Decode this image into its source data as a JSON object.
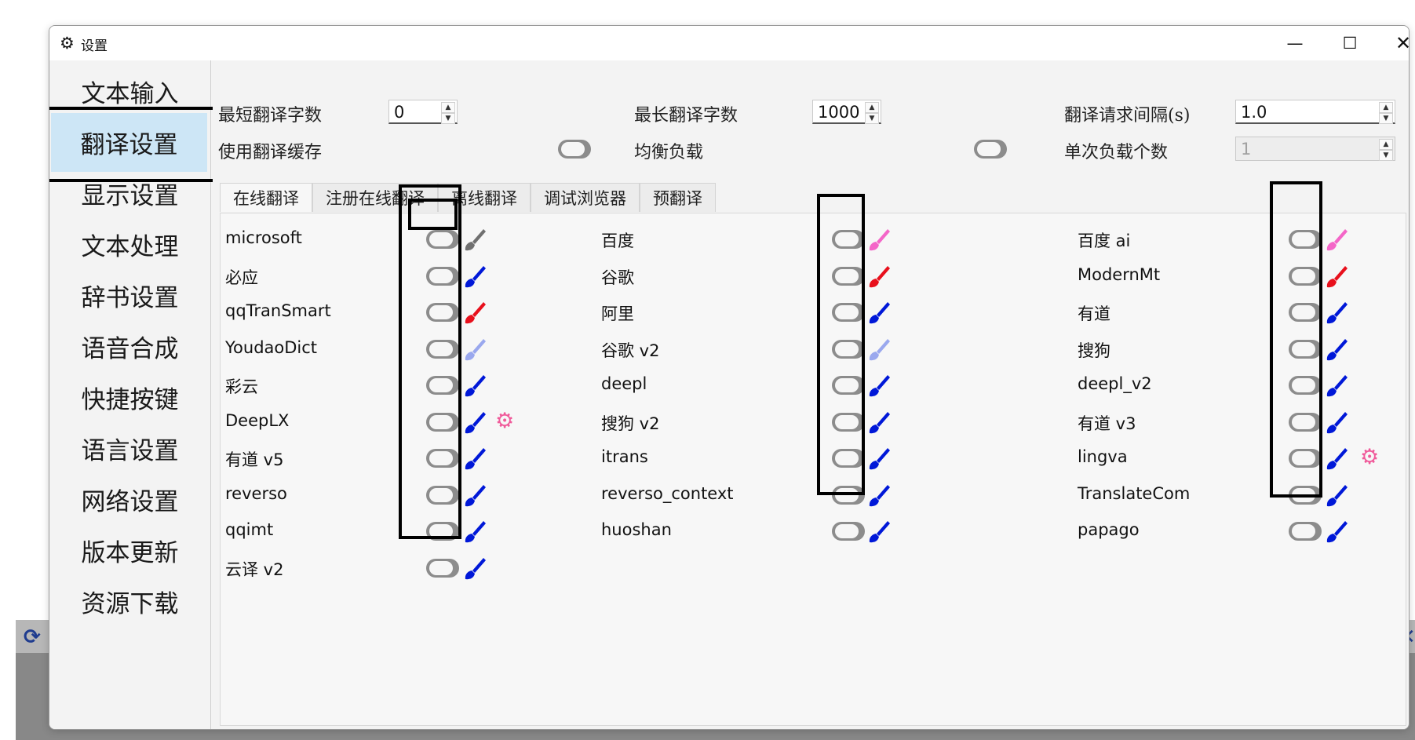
{
  "window": {
    "title": "设置",
    "title_icon": "gear-icon",
    "controls": [
      "minimize",
      "maximize",
      "close"
    ]
  },
  "background": {
    "left_icon": "refresh-icon",
    "right_icon": "close-icon"
  },
  "sidebar": {
    "items": [
      {
        "label": "文本输入"
      },
      {
        "label": "翻译设置",
        "active": true
      },
      {
        "label": "显示设置"
      },
      {
        "label": "文本处理"
      },
      {
        "label": "辞书设置"
      },
      {
        "label": "语音合成"
      },
      {
        "label": "快捷按键"
      },
      {
        "label": "语言设置"
      },
      {
        "label": "网络设置"
      },
      {
        "label": "版本更新"
      },
      {
        "label": "资源下载"
      }
    ]
  },
  "settings": {
    "min_chars_label": "最短翻译字数",
    "min_chars_value": "0",
    "max_chars_label": "最长翻译字数",
    "max_chars_value": "1000",
    "interval_label": "翻译请求间隔(s)",
    "interval_value": "1.0",
    "cache_label": "使用翻译缓存",
    "balance_label": "均衡负载",
    "per_load_label": "单次负载个数",
    "per_load_value": "1"
  },
  "tabs": [
    {
      "label": "在线翻译",
      "active": true
    },
    {
      "label": "注册在线翻译"
    },
    {
      "label": "离线翻译"
    },
    {
      "label": "调试浏览器"
    },
    {
      "label": "预翻译"
    }
  ],
  "translators": {
    "col1": [
      {
        "name": "microsoft",
        "color": "#707070"
      },
      {
        "name": "必应",
        "color": "#0018d8"
      },
      {
        "name": "qqTranSmart",
        "color": "#e8101c"
      },
      {
        "name": "YoudaoDict",
        "color": "#9aa8ee"
      },
      {
        "name": "彩云",
        "color": "#0018d8"
      },
      {
        "name": "DeepLX",
        "color": "#0018d8",
        "gear": true
      },
      {
        "name": "有道 v5",
        "color": "#0018d8"
      },
      {
        "name": "reverso",
        "color": "#0018d8"
      },
      {
        "name": "qqimt",
        "color": "#0018d8"
      },
      {
        "name": "云译 v2",
        "color": "#0018d8"
      }
    ],
    "col2": [
      {
        "name": "百度",
        "color": "#f466c8"
      },
      {
        "name": "谷歌",
        "color": "#e8101c"
      },
      {
        "name": "阿里",
        "color": "#0018d8"
      },
      {
        "name": "谷歌 v2",
        "color": "#9aa8ee"
      },
      {
        "name": "deepl",
        "color": "#0018d8"
      },
      {
        "name": "搜狗 v2",
        "color": "#0018d8"
      },
      {
        "name": "itrans",
        "color": "#0018d8"
      },
      {
        "name": "reverso_context",
        "color": "#0018d8"
      },
      {
        "name": "huoshan",
        "color": "#0018d8"
      }
    ],
    "col3": [
      {
        "name": "百度 ai",
        "color": "#f466c8"
      },
      {
        "name": "ModernMt",
        "color": "#e8101c"
      },
      {
        "name": "有道",
        "color": "#0018d8"
      },
      {
        "name": "搜狗",
        "color": "#0018d8"
      },
      {
        "name": "deepl_v2",
        "color": "#0018d8"
      },
      {
        "name": "有道 v3",
        "color": "#0018d8"
      },
      {
        "name": "lingva",
        "color": "#0018d8",
        "gear": true
      },
      {
        "name": "TranslateCom",
        "color": "#0018d8"
      },
      {
        "name": "papago",
        "color": "#0018d8"
      }
    ]
  }
}
